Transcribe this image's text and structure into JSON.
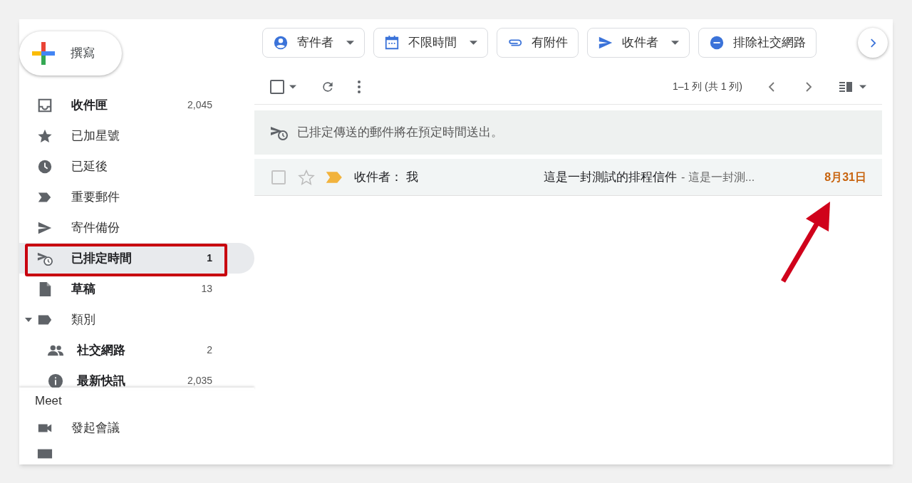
{
  "compose": {
    "label": "撰寫"
  },
  "sidebar": {
    "items": [
      {
        "label": "收件匣",
        "count": "2,045",
        "bold": true,
        "selected": false
      },
      {
        "label": "已加星號",
        "bold": false,
        "selected": false
      },
      {
        "label": "已延後",
        "bold": false,
        "selected": false
      },
      {
        "label": "重要郵件",
        "bold": false,
        "selected": false
      },
      {
        "label": "寄件備份",
        "bold": false,
        "selected": false
      },
      {
        "label": "已排定時間",
        "count": "1",
        "bold": true,
        "selected": true
      },
      {
        "label": "草稿",
        "count": "13",
        "bold": true,
        "selected": false
      },
      {
        "label": "類別",
        "bold": false,
        "selected": false,
        "expanded": true,
        "children": [
          {
            "label": "社交網路",
            "count": "2",
            "bold": true,
            "selected": false
          },
          {
            "label": "最新快訊",
            "count": "2,035",
            "bold": true,
            "selected": false
          }
        ]
      }
    ]
  },
  "meet": {
    "title": "Meet",
    "items": [
      {
        "label": "發起會議"
      }
    ]
  },
  "filter_chips": [
    {
      "label": "寄件者",
      "dropdown": true
    },
    {
      "label": "不限時間",
      "dropdown": true
    },
    {
      "label": "有附件",
      "dropdown": false
    },
    {
      "label": "收件者",
      "dropdown": true
    },
    {
      "label": "排除社交網路",
      "dropdown": false
    }
  ],
  "toolbar": {
    "select_all": {
      "checked": false
    },
    "pagination": "1–1 列 (共 1 列)"
  },
  "banner": {
    "text": "已排定傳送的郵件將在預定時間送出。"
  },
  "messages": [
    {
      "checked": false,
      "starred": false,
      "important": true,
      "sender": "收件者： 我",
      "subject": "這是一封測試的排程信件",
      "snippet": "- 這是一封測...",
      "date": "8月31日"
    }
  ]
}
